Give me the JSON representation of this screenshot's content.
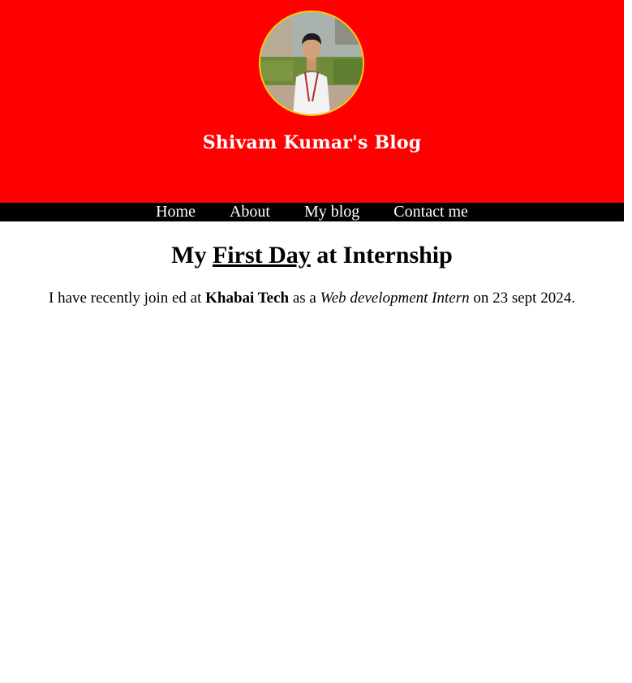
{
  "header": {
    "background_color": "#ff0000",
    "avatar_border_color": "#ffcc00",
    "title": "Shivam Kumar's Blog"
  },
  "nav": {
    "items": [
      {
        "label": "Home"
      },
      {
        "label": "About"
      },
      {
        "label": "My blog"
      },
      {
        "label": "Contact me"
      }
    ]
  },
  "post": {
    "title_prefix": "My ",
    "title_underlined": "First Day",
    "title_suffix": " at Internship",
    "body_part1": "I have recently join ed at ",
    "body_company": "Khabai Tech",
    "body_part2": " as a ",
    "body_role": "Web development Intern",
    "body_part3": " on 23 sept 2024."
  }
}
